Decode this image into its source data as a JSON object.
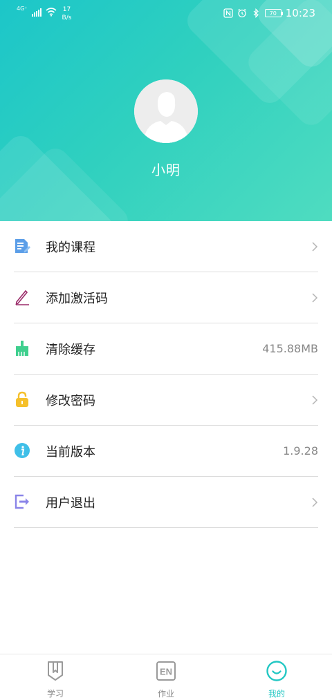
{
  "status_bar": {
    "network": "4G⁺",
    "speed_value": "17",
    "speed_unit": "B/s",
    "battery": "70",
    "time": "10:23"
  },
  "profile": {
    "name": "小明"
  },
  "menu": {
    "items": [
      {
        "label": "我的课程",
        "value": "",
        "icon": "course-document-icon"
      },
      {
        "label": "添加激活码",
        "value": "",
        "icon": "pen-icon"
      },
      {
        "label": "清除缓存",
        "value": "415.88MB",
        "icon": "broom-icon"
      },
      {
        "label": "修改密码",
        "value": "",
        "icon": "lock-icon"
      },
      {
        "label": "当前版本",
        "value": "1.9.28",
        "icon": "info-icon"
      },
      {
        "label": "用户退出",
        "value": "",
        "icon": "logout-icon"
      }
    ]
  },
  "bottom_nav": {
    "tabs": [
      {
        "label": "学习",
        "icon": "book-icon",
        "active": false
      },
      {
        "label": "作业",
        "icon": "en-homework-icon",
        "icon_text": "EN",
        "active": false
      },
      {
        "label": "我的",
        "icon": "smile-icon",
        "active": true
      }
    ]
  },
  "colors": {
    "header_start": "#1cc6c9",
    "header_end": "#4fdcc0",
    "accent": "#22c7c3"
  }
}
